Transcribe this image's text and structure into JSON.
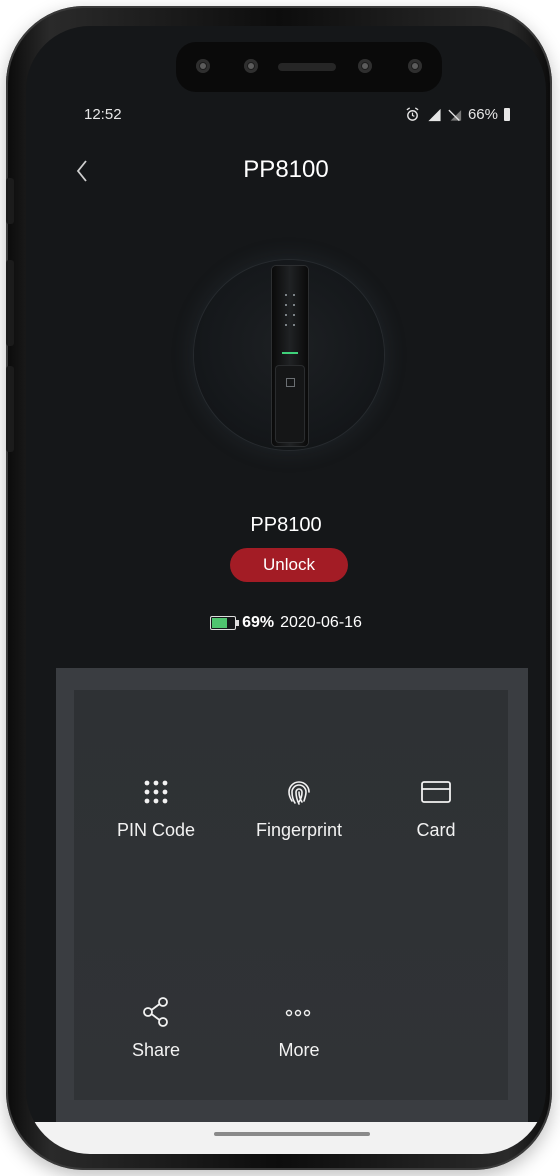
{
  "status_bar": {
    "time": "12:52",
    "battery_percent": "66%",
    "icons": [
      "alarm-icon",
      "signal-icon",
      "no-sim-icon",
      "battery-icon"
    ]
  },
  "header": {
    "title": "PP8100",
    "back_icon": "chevron-left-icon"
  },
  "device": {
    "name": "PP8100",
    "unlock_label": "Unlock",
    "battery_percent": "69%",
    "battery_level": 0.69,
    "date": "2020-06-16"
  },
  "menu": {
    "items": [
      {
        "label": "PIN Code",
        "icon": "keypad-icon"
      },
      {
        "label": "Fingerprint",
        "icon": "fingerprint-icon"
      },
      {
        "label": "Card",
        "icon": "card-icon"
      },
      {
        "label": "Share",
        "icon": "share-icon"
      },
      {
        "label": "More",
        "icon": "more-icon"
      }
    ]
  },
  "colors": {
    "accent": "#a31c25",
    "battery_green": "#4fc46f",
    "background": "#151719",
    "panel": "#3a3d41"
  }
}
